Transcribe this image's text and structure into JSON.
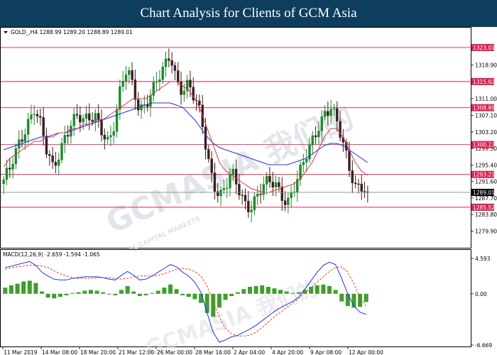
{
  "banner": {
    "title": "Chart Analysis for Clients of GCM Asia"
  },
  "colors": {
    "banner_bg": "#0f3d5e",
    "bull_candle": "#1f8a2e",
    "bear_candle": "#3a1f1f",
    "ma_fast": "#e0314b",
    "ma_slow": "#2233dd",
    "level_line": "#d6244f",
    "macd_hist": "#3f9e2f",
    "macd_signal": "#ff3b1f",
    "macd_line": "#2233dd"
  },
  "watermark": {
    "text": "GCMASIA 我们的",
    "subtext": "GLOBAL CAPITAL MARKETS"
  },
  "chart_data": {
    "type": "candlestick",
    "symbol_header": "GOLD_,H4  1288.99 1289.20 1288.89 1289.01",
    "ylim": [
      1276.5,
      1325.5
    ],
    "y_ticks": [
      "1318.90",
      "1311.00",
      "1307.10",
      "1303.20",
      "1299.30",
      "1295.40",
      "1291.60",
      "1287.70",
      "1283.80",
      "1279.90"
    ],
    "level_lines": [
      1323.01,
      1315.02,
      1308.89,
      1300.22,
      1293.21,
      1285.52
    ],
    "level_labels": [
      "1323.01",
      "1315.02",
      "1308.89",
      "1300.22",
      "1293.21",
      "1285.52"
    ],
    "current_price": 1289.01,
    "current_label": "1289.01",
    "x_ticks": [
      "11 Mar 2019",
      "14 Mar 08:00",
      "18 Mar 20:00",
      "21 Mar 12:00",
      "26 Mar 00:00",
      "28 Mar 16:00",
      "2 Apr 04:00",
      "4 Apr 20:00",
      "9 Apr 08:00",
      "12 Apr 00:00"
    ],
    "close_path": [
      1292,
      1294,
      1298,
      1302,
      1306,
      1309.5,
      1305,
      1298,
      1294,
      1298,
      1303,
      1306,
      1307,
      1305,
      1306,
      1307,
      1304,
      1301,
      1305,
      1313,
      1318,
      1314,
      1309,
      1310,
      1312,
      1315,
      1318,
      1322,
      1316,
      1313,
      1314,
      1310,
      1307,
      1298,
      1292,
      1288,
      1290,
      1293,
      1290,
      1287,
      1286,
      1288,
      1290,
      1291,
      1291,
      1289,
      1287,
      1290,
      1293,
      1297,
      1301,
      1305,
      1308,
      1309,
      1305,
      1300,
      1295,
      1291,
      1291,
      1289.01
    ],
    "ma_fast": [
      1295,
      1297,
      1298,
      1299,
      1300,
      1301,
      1301,
      1302,
      1302,
      1303,
      1303,
      1304,
      1304,
      1305,
      1305,
      1306,
      1306,
      1307,
      1308,
      1309,
      1310,
      1311,
      1311,
      1311,
      1312,
      1313,
      1314,
      1315,
      1315,
      1314,
      1313,
      1311,
      1308,
      1304,
      1300,
      1296,
      1294,
      1293,
      1292,
      1291,
      1290,
      1289.5,
      1289,
      1289,
      1289.5,
      1290,
      1290.5,
      1291,
      1292,
      1294,
      1296,
      1299,
      1302,
      1304,
      1304,
      1302,
      1299,
      1296,
      1294,
      1293
    ],
    "ma_slow": [
      1299,
      1299.5,
      1300,
      1300.5,
      1301,
      1301.5,
      1302,
      1302,
      1302.5,
      1303,
      1303,
      1303.5,
      1304,
      1304.5,
      1305,
      1305.5,
      1306,
      1306.5,
      1307,
      1307.5,
      1308,
      1308.5,
      1309,
      1309.5,
      1310,
      1310,
      1310,
      1310,
      1309.5,
      1309,
      1307.5,
      1306,
      1304,
      1302,
      1300.5,
      1299.5,
      1299,
      1298.5,
      1298,
      1297.5,
      1297,
      1296.5,
      1296,
      1295.5,
      1295.5,
      1295.5,
      1295.5,
      1296,
      1296.5,
      1297,
      1298,
      1299,
      1300,
      1300.5,
      1300.5,
      1300,
      1299,
      1298,
      1297,
      1296
    ],
    "macd": {
      "label": "MACD(12,26,9) -2.659 -1.594 -1.065",
      "ylim": [
        -6.669,
        4.593
      ],
      "y_ticks": [
        "4.593",
        "0.00",
        "-6.669"
      ],
      "hist": [
        0.8,
        1.1,
        1.3,
        1.6,
        1.7,
        1.4,
        0.3,
        -0.5,
        -0.6,
        -0.4,
        -0.2,
        0.1,
        0.2,
        0.4,
        0.5,
        0.4,
        0.2,
        -0.1,
        -0.2,
        0.5,
        1.0,
        0.3,
        -0.3,
        -0.2,
        0.1,
        0.4,
        0.8,
        1.2,
        0.6,
        -0.2,
        -0.4,
        -0.7,
        -1.2,
        -2.5,
        -3.0,
        -1.8,
        -0.8,
        -0.3,
        0.2,
        0.6,
        0.9,
        1.0,
        1.1,
        0.9,
        0.7,
        0.5,
        0.3,
        0.1,
        0.2,
        0.5,
        0.9,
        1.1,
        1.2,
        1.0,
        0.5,
        -1.0,
        -1.6,
        -1.8,
        -1.7,
        -1.065
      ],
      "signal": [
        3.2,
        3.4,
        3.5,
        3.6,
        3.7,
        3.7,
        3.6,
        3.4,
        3.0,
        2.6,
        2.3,
        2.1,
        2.0,
        2.0,
        2.0,
        2.1,
        2.1,
        2.1,
        2.0,
        1.9,
        2.0,
        2.2,
        2.3,
        2.3,
        2.3,
        2.4,
        2.6,
        2.9,
        3.2,
        3.3,
        3.2,
        2.9,
        2.3,
        1.0,
        -1.0,
        -3.0,
        -4.5,
        -5.2,
        -5.5,
        -5.5,
        -5.4,
        -5.0,
        -4.4,
        -3.7,
        -3.0,
        -2.4,
        -1.8,
        -1.2,
        -0.6,
        0.1,
        0.8,
        1.5,
        2.2,
        2.9,
        3.4,
        3.5,
        2.8,
        1.3,
        -0.5,
        -1.594
      ],
      "line": [
        3.4,
        3.6,
        3.8,
        4.0,
        4.2,
        3.7,
        2.8,
        2.3,
        1.9,
        1.8,
        1.8,
        2.0,
        2.1,
        2.2,
        2.2,
        2.2,
        2.1,
        1.9,
        1.8,
        2.4,
        2.9,
        2.4,
        1.8,
        1.9,
        2.3,
        2.8,
        3.3,
        3.8,
        3.5,
        2.8,
        2.3,
        1.5,
        0.2,
        -2.5,
        -5.0,
        -6.3,
        -6.0,
        -5.6,
        -5.4,
        -5.0,
        -4.6,
        -4.1,
        -3.5,
        -2.9,
        -2.3,
        -1.8,
        -1.4,
        -1.0,
        -0.4,
        0.6,
        1.7,
        2.8,
        3.7,
        4.1,
        3.8,
        2.0,
        0.0,
        -1.6,
        -2.4,
        -2.659
      ]
    }
  }
}
